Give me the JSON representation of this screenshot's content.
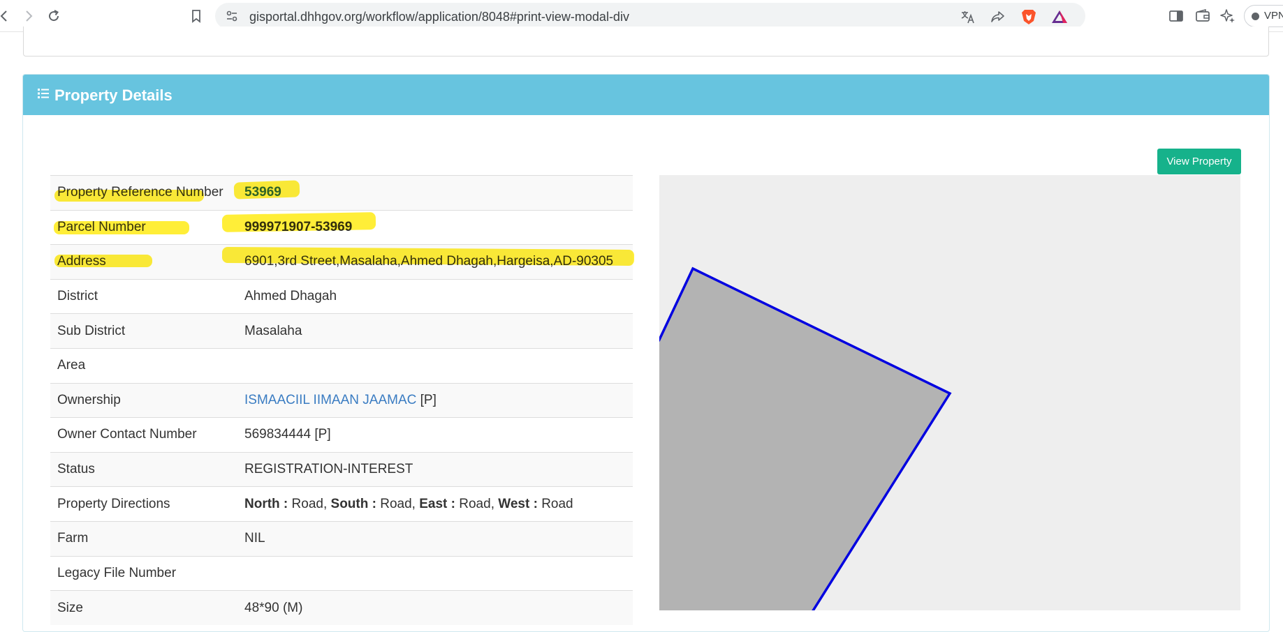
{
  "browser": {
    "url": "gisportal.dhhgov.org/workflow/application/8048#print-view-modal-div",
    "vpn_label": "VPN"
  },
  "panel": {
    "title": "Property Details",
    "view_property_label": "View Property"
  },
  "details": {
    "property_reference_number": {
      "label": "Property Reference Number",
      "value": "53969"
    },
    "parcel_number": {
      "label": "Parcel Number",
      "value": "999971907-53969"
    },
    "address": {
      "label": "Address",
      "value": "6901,3rd Street,Masalaha,Ahmed Dhagah,Hargeisa,AD-90305"
    },
    "district": {
      "label": "District",
      "value": "Ahmed Dhagah"
    },
    "sub_district": {
      "label": "Sub District",
      "value": "Masalaha"
    },
    "area": {
      "label": "Area",
      "value": ""
    },
    "ownership": {
      "label": "Ownership",
      "owner_name": "ISMAACIIL IIMAAN JAAMAC",
      "owner_tag": "[P]"
    },
    "owner_contact": {
      "label": "Owner Contact Number",
      "value": "569834444 [P]"
    },
    "status": {
      "label": "Status",
      "value": "REGISTRATION-INTEREST"
    },
    "property_directions": {
      "label": "Property Directions",
      "north_label": "North",
      "north_value": "Road",
      "south_label": "South",
      "south_value": "Road",
      "east_label": "East",
      "east_value": "Road",
      "west_label": "West",
      "west_value": "Road",
      "separator": " : "
    },
    "farm": {
      "label": "Farm",
      "value": "NIL"
    },
    "legacy_file_number": {
      "label": "Legacy File Number",
      "value": ""
    },
    "size": {
      "label": "Size",
      "value": "48*90 (M)"
    }
  },
  "colors": {
    "header_bg": "#67c4df",
    "button_bg": "#16b28b",
    "link": "#3a7cc2",
    "highlighter": "#ffea00",
    "parcel_fill": "#b3b3b3",
    "parcel_stroke": "#0000e0",
    "map_bg": "#eeeeee"
  },
  "icons": {
    "header": "list-icon",
    "browser": [
      "back-icon",
      "forward-icon",
      "reload-icon",
      "bookmark-icon",
      "site-info-icon",
      "translate-icon",
      "share-icon",
      "brave-shield-icon",
      "brave-rewards-icon",
      "sidebar-icon",
      "wallet-icon",
      "leo-ai-icon"
    ]
  }
}
